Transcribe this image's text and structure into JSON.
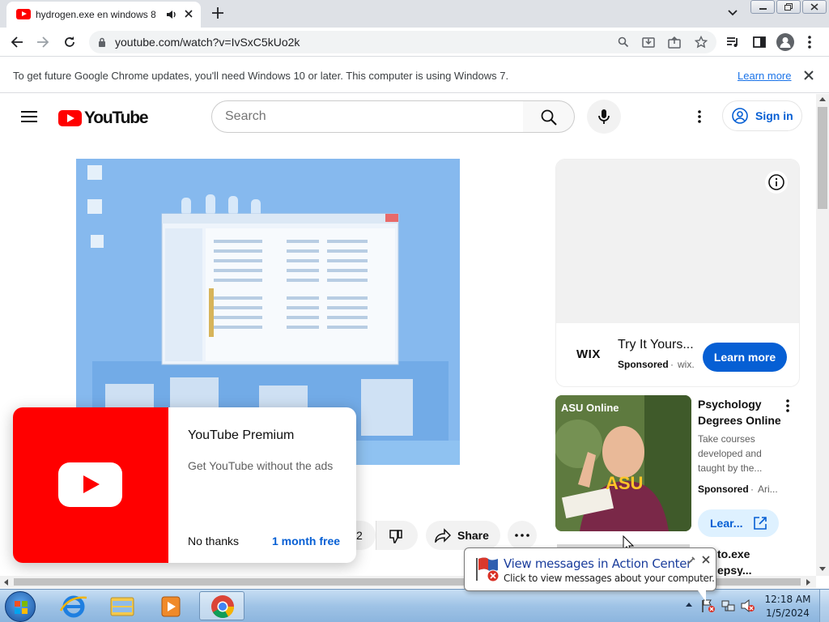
{
  "browser": {
    "tab_title": "hydrogen.exe en windows 8",
    "url": "youtube.com/watch?v=IvSxC5kUo2k",
    "infobar_text": "To get future Google Chrome updates, you'll need Windows 10 or later. This computer is using Windows 7.",
    "infobar_link": "Learn more"
  },
  "youtube": {
    "logo_text": "YouTube",
    "search_placeholder": "Search",
    "signin_label": "Sign in",
    "like_count": "2",
    "share_label": "Share"
  },
  "ad": {
    "brand": "WIX",
    "title": "Try It Yours...",
    "sponsored": "Sponsored",
    "domain": "wix.",
    "cta": "Learn more"
  },
  "sponsored_item": {
    "thumb_brand": "ASU Online",
    "title": "Psychology Degrees Online",
    "description": "Take courses developed and taught by the...",
    "sponsored": "Sponsored",
    "advertiser": "Ari...",
    "cta": "Lear..."
  },
  "next_item_partial": {
    "title_line1": "to.exe",
    "title_line2": "epsy..."
  },
  "premium_popup": {
    "title": "YouTube Premium",
    "subtitle": "Get YouTube without the ads",
    "no_thanks": "No thanks",
    "trial": "1 month free"
  },
  "notification": {
    "title": "View messages in Action Center",
    "body": "Click to view messages about your computer."
  },
  "taskbar": {
    "time": "12:18 AM",
    "date": "1/5/2024"
  },
  "colors": {
    "youtube_red": "#ff0000",
    "link_blue": "#065fd4",
    "cta_blue": "#065fd4"
  }
}
